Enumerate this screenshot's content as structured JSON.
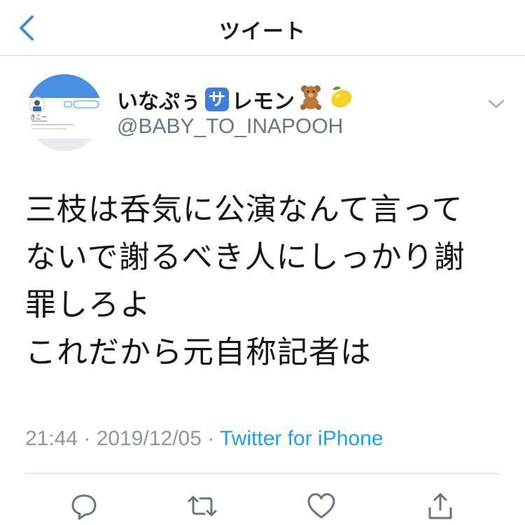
{
  "nav": {
    "title": "ツイート"
  },
  "author": {
    "name_prefix": "いなぷぅ",
    "badge_char": "サ",
    "name_suffix": "レモン",
    "handle": "@BABY_TO_INAPOOH",
    "avatar_text": "きこー"
  },
  "tweet": {
    "lines": [
      "三枝は呑気に公演なんて言って",
      "ないで謝るべき人にしっかり謝",
      "罪しろよ",
      "これだから元自称記者は"
    ]
  },
  "meta": {
    "time": "21:44",
    "sep1": " · ",
    "date": "2019/12/05",
    "sep2": " · ",
    "source": "Twitter for iPhone"
  },
  "actions": [
    "reply-icon",
    "retweet-icon",
    "like-icon",
    "share-icon"
  ],
  "colors": {
    "accent": "#1da1f2",
    "back": "#3b8ede",
    "muted": "#8899a6",
    "text": "#14171a",
    "divider": "#d9d9d9"
  }
}
